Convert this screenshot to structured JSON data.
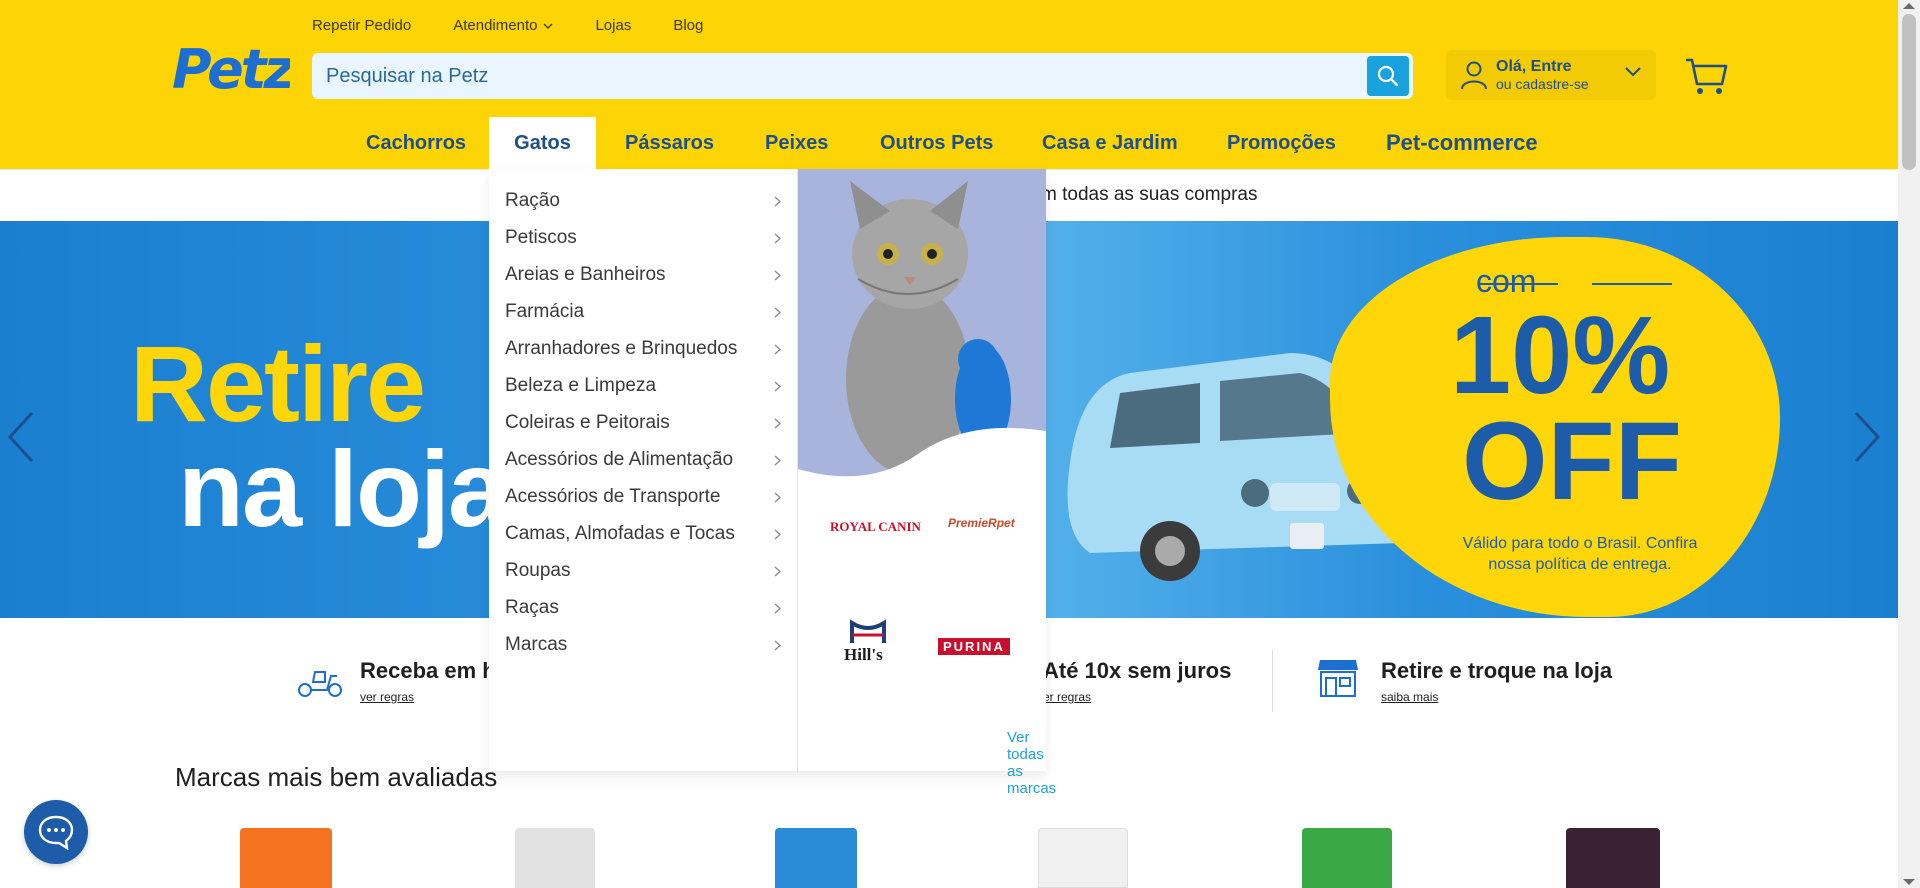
{
  "topnav": {
    "items": [
      {
        "label": "Repetir Pedido"
      },
      {
        "label": "Atendimento"
      },
      {
        "label": "Lojas"
      },
      {
        "label": "Blog"
      }
    ]
  },
  "logo": {
    "text": "Petz"
  },
  "search": {
    "placeholder": "Pesquisar na Petz"
  },
  "account": {
    "greeting": "Olá, Entre",
    "sub": "ou cadastre-se"
  },
  "categories": [
    {
      "label": "Cachorros",
      "active": false
    },
    {
      "label": "Gatos",
      "active": true
    },
    {
      "label": "Pássaros",
      "active": false
    },
    {
      "label": "Peixes",
      "active": false
    },
    {
      "label": "Outros Pets",
      "active": false
    },
    {
      "label": "Casa e Jardim",
      "active": false
    },
    {
      "label": "Promoções",
      "active": false
    },
    {
      "label": "Pet-commerce",
      "active": false
    }
  ],
  "strip": {
    "text": "m todas as suas compras"
  },
  "banner": {
    "left_line1": "Retire",
    "left_line2": "na loja",
    "com": "com",
    "percent": "10%",
    "off": "OFF",
    "valid": "Válido para todo o Brasil. Confira nossa política de entrega."
  },
  "mega_menu": {
    "items": [
      {
        "label": "Ração"
      },
      {
        "label": "Petiscos"
      },
      {
        "label": "Areias e Banheiros"
      },
      {
        "label": "Farmácia"
      },
      {
        "label": "Arranhadores e Brinquedos"
      },
      {
        "label": "Beleza e Limpeza"
      },
      {
        "label": "Coleiras e Peitorais"
      },
      {
        "label": "Acessórios de Alimentação"
      },
      {
        "label": "Acessórios de Transporte"
      },
      {
        "label": "Camas, Almofadas e Tocas"
      },
      {
        "label": "Roupas"
      },
      {
        "label": "Raças"
      },
      {
        "label": "Marcas"
      }
    ],
    "brands": [
      "ROYAL CANIN",
      "PremieRpet",
      "Hill's",
      "PURINA"
    ],
    "see_all": "Ver todas as marcas"
  },
  "info": {
    "delivery": {
      "title": "Receba em h",
      "link": "ver regras"
    },
    "installments": {
      "title": "Até 10x sem juros",
      "link": "er regras"
    },
    "store": {
      "title": "Retire e troque na loja",
      "link": "saiba mais"
    }
  },
  "rated": {
    "title": "Marcas mais bem avaliadas"
  },
  "colors": {
    "brand_yellow": "#fdd405",
    "brand_blue": "#1c4f8c",
    "accent": "#1aa2de"
  }
}
